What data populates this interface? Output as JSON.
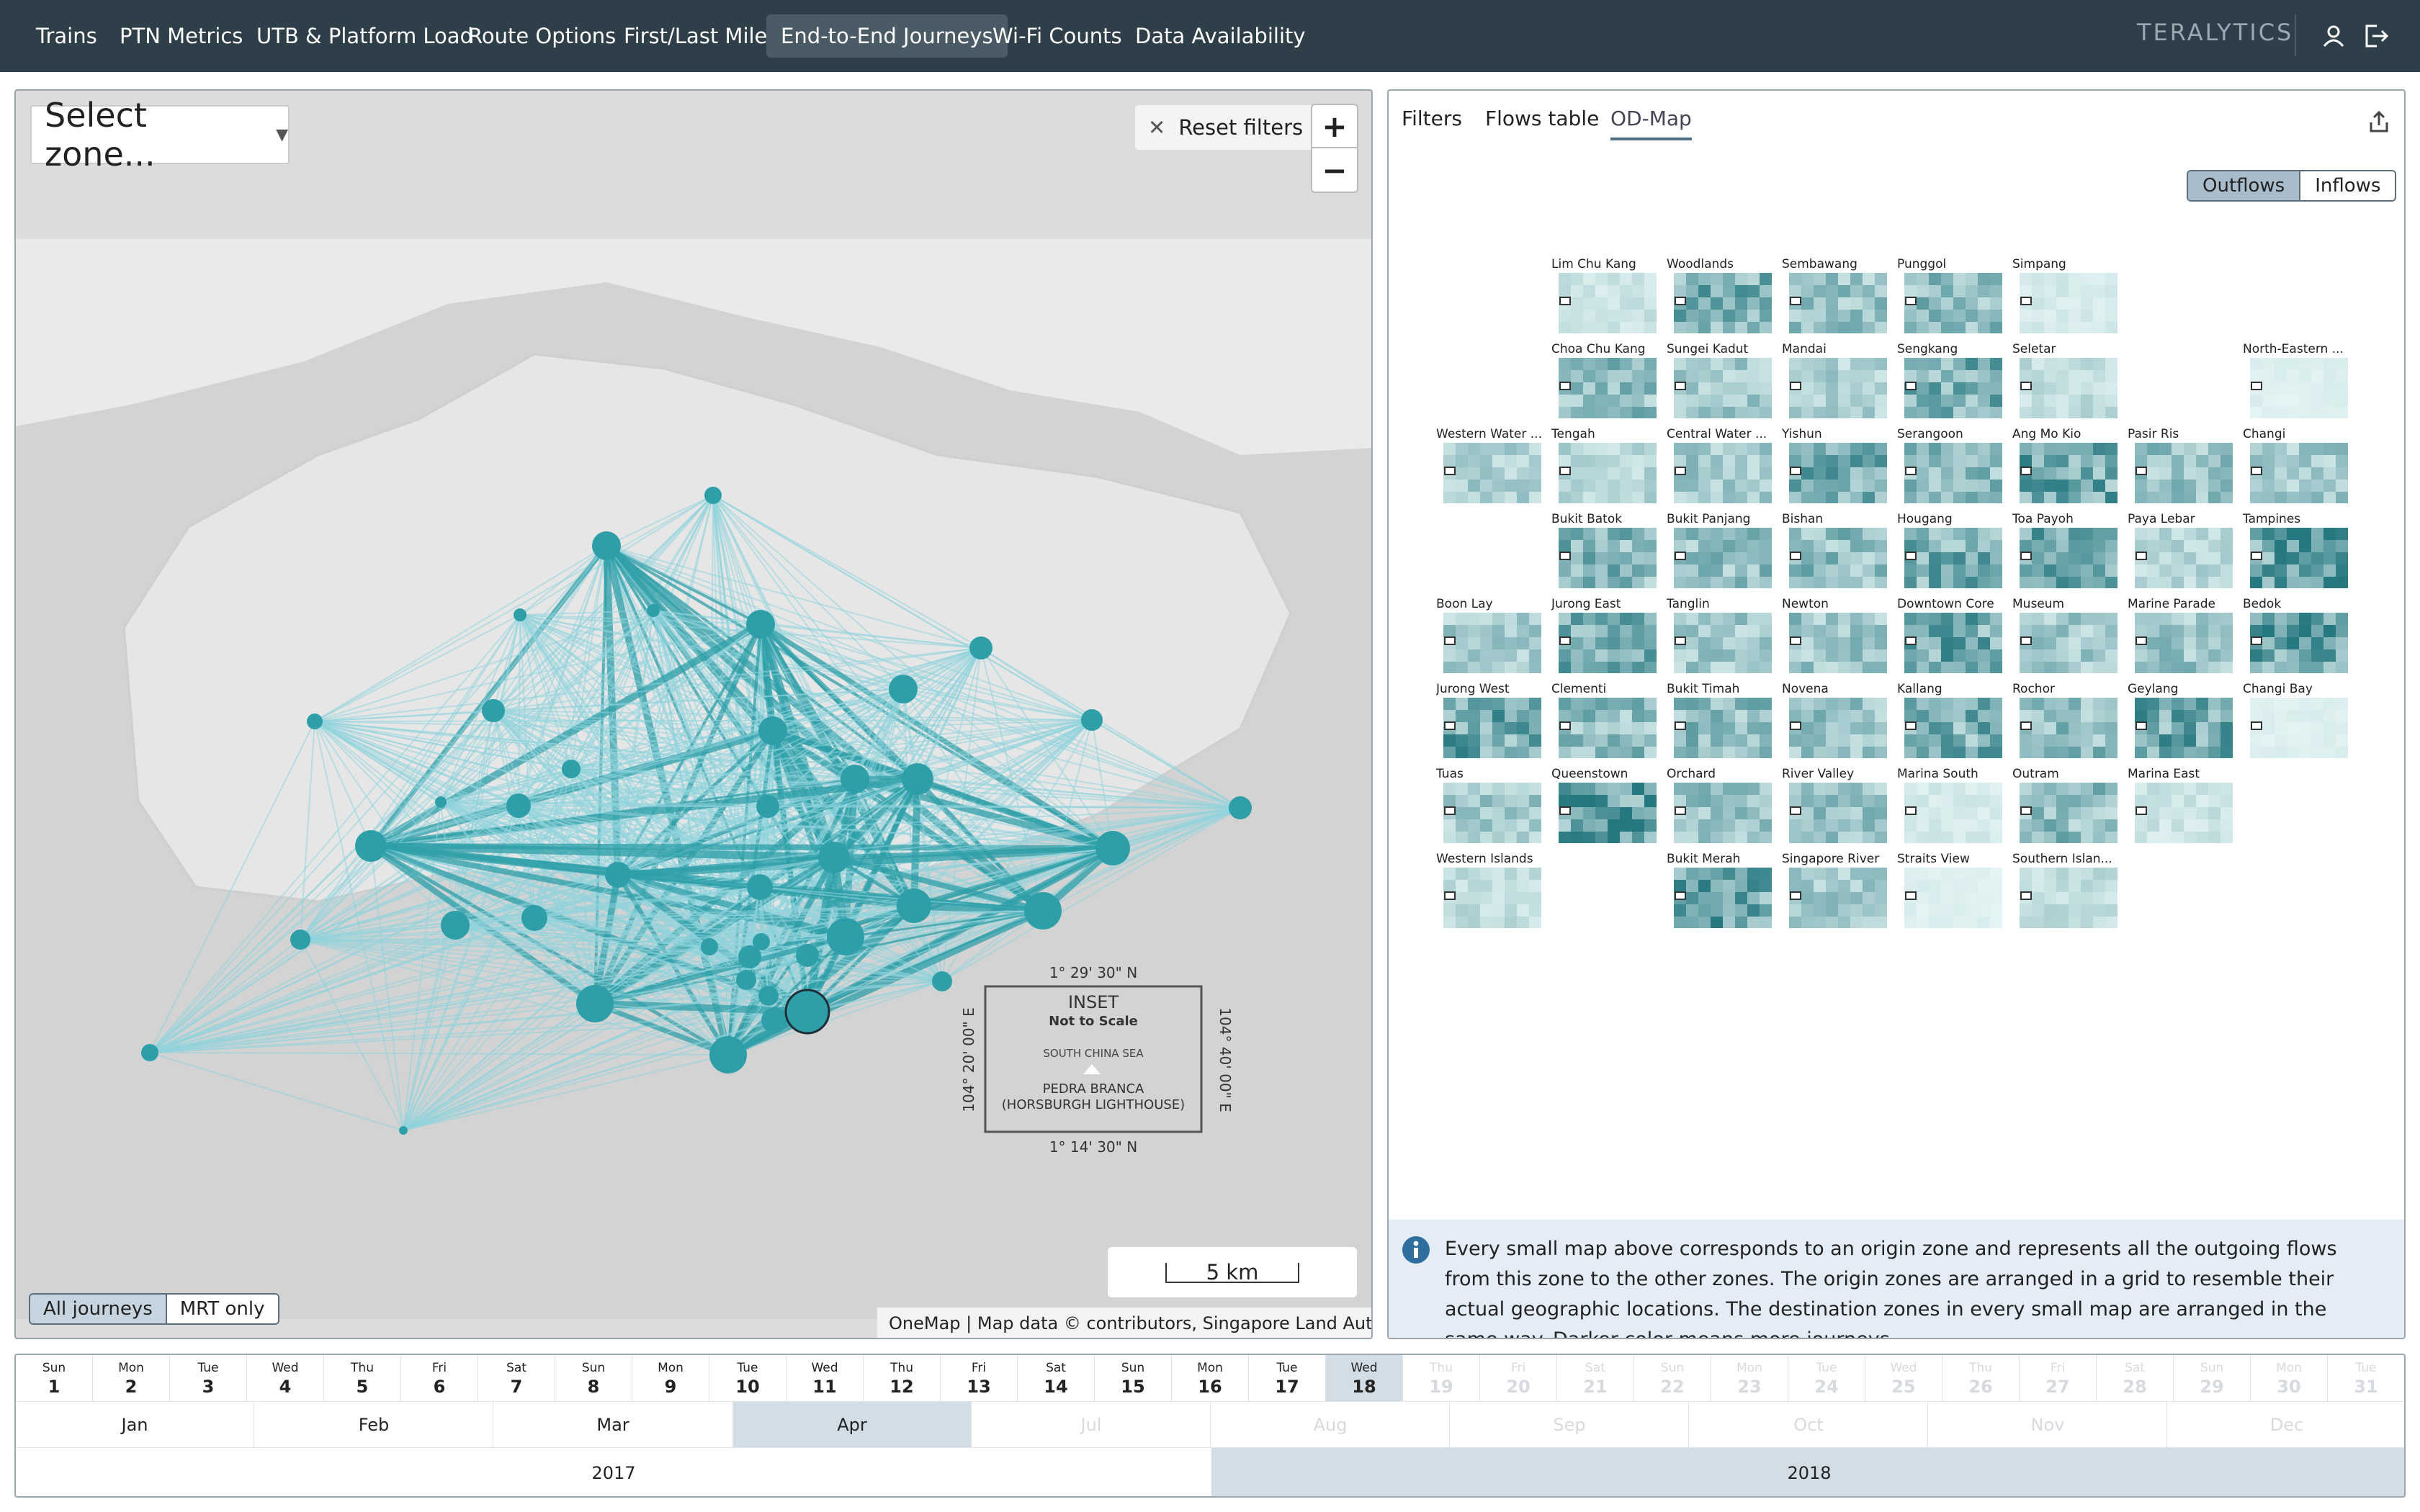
{
  "nav": {
    "tabs": [
      "Trains",
      "PTN Metrics",
      "UTB & Platform Load",
      "Route Options",
      "First/Last Mile",
      "End-to-End Journeys",
      "Wi-Fi Counts",
      "Data Availability"
    ],
    "active_tab": "End-to-End Journeys",
    "brand": "TERALYTICS",
    "user_icon": "user-icon",
    "logout_icon": "logout-icon"
  },
  "map": {
    "zone_select": "Select zone...",
    "reset_filters": "Reset filters",
    "zoom_in": "+",
    "zoom_out": "−",
    "scale_label": "5 km",
    "attribution": "OneMap | Map data © contributors, Singapore Land Authority",
    "journey_modes": [
      "All journeys",
      "MRT only"
    ],
    "active_mode": "All journeys",
    "flow_color": "#2e9fa8",
    "inset": {
      "title": "INSET",
      "subtitle": "Not to Scale",
      "sea": "SOUTH CHINA SEA",
      "island": "PEDRA BRANCA",
      "lighthouse": "(HORSBURGH LIGHTHOUSE)",
      "lat_top": "1° 29' 30\" N",
      "lat_bottom": "1° 14' 30\" N",
      "lon_left": "104° 20' 00\" E",
      "lon_right": "104° 40' 00\" E"
    }
  },
  "right_panel": {
    "tabs": [
      "Filters",
      "Flows table",
      "OD-Map"
    ],
    "active_tab": "OD-Map",
    "flow_modes": [
      "Outflows",
      "Inflows"
    ],
    "active_flow": "Outflows",
    "zones": [
      {
        "name": "Lim Chu Kang",
        "col": 1,
        "row": 0,
        "intensity": 0.15
      },
      {
        "name": "Woodlands",
        "col": 2,
        "row": 0,
        "intensity": 0.55
      },
      {
        "name": "Sembawang",
        "col": 3,
        "row": 0,
        "intensity": 0.4
      },
      {
        "name": "Punggol",
        "col": 4,
        "row": 0,
        "intensity": 0.45
      },
      {
        "name": "Simpang",
        "col": 5,
        "row": 0,
        "intensity": 0.1
      },
      {
        "name": "Choa Chu Kang",
        "col": 1,
        "row": 1,
        "intensity": 0.45
      },
      {
        "name": "Sungei Kadut",
        "col": 2,
        "row": 1,
        "intensity": 0.35
      },
      {
        "name": "Mandai",
        "col": 3,
        "row": 1,
        "intensity": 0.3
      },
      {
        "name": "Sengkang",
        "col": 4,
        "row": 1,
        "intensity": 0.55
      },
      {
        "name": "Seletar",
        "col": 5,
        "row": 1,
        "intensity": 0.2
      },
      {
        "name": "North-Eastern ...",
        "col": 7,
        "row": 1,
        "intensity": 0.05
      },
      {
        "name": "Western Water ...",
        "col": 0,
        "row": 2,
        "intensity": 0.3
      },
      {
        "name": "Tengah",
        "col": 1,
        "row": 2,
        "intensity": 0.25
      },
      {
        "name": "Central Water ...",
        "col": 2,
        "row": 2,
        "intensity": 0.35
      },
      {
        "name": "Yishun",
        "col": 3,
        "row": 2,
        "intensity": 0.55
      },
      {
        "name": "Serangoon",
        "col": 4,
        "row": 2,
        "intensity": 0.45
      },
      {
        "name": "Ang Mo Kio",
        "col": 5,
        "row": 2,
        "intensity": 0.6
      },
      {
        "name": "Pasir Ris",
        "col": 6,
        "row": 2,
        "intensity": 0.4
      },
      {
        "name": "Changi",
        "col": 7,
        "row": 2,
        "intensity": 0.35
      },
      {
        "name": "Bukit Batok",
        "col": 1,
        "row": 3,
        "intensity": 0.5
      },
      {
        "name": "Bukit Panjang",
        "col": 2,
        "row": 3,
        "intensity": 0.45
      },
      {
        "name": "Bishan",
        "col": 3,
        "row": 3,
        "intensity": 0.45
      },
      {
        "name": "Hougang",
        "col": 4,
        "row": 3,
        "intensity": 0.55
      },
      {
        "name": "Toa Payoh",
        "col": 5,
        "row": 3,
        "intensity": 0.6
      },
      {
        "name": "Paya Lebar",
        "col": 6,
        "row": 3,
        "intensity": 0.25
      },
      {
        "name": "Tampines",
        "col": 7,
        "row": 3,
        "intensity": 0.7
      },
      {
        "name": "Boon Lay",
        "col": 0,
        "row": 4,
        "intensity": 0.35
      },
      {
        "name": "Jurong East",
        "col": 1,
        "row": 4,
        "intensity": 0.55
      },
      {
        "name": "Tanglin",
        "col": 2,
        "row": 4,
        "intensity": 0.35
      },
      {
        "name": "Newton",
        "col": 3,
        "row": 4,
        "intensity": 0.4
      },
      {
        "name": "Downtown Core",
        "col": 4,
        "row": 4,
        "intensity": 0.6
      },
      {
        "name": "Museum",
        "col": 5,
        "row": 4,
        "intensity": 0.35
      },
      {
        "name": "Marine Parade",
        "col": 6,
        "row": 4,
        "intensity": 0.4
      },
      {
        "name": "Bedok",
        "col": 7,
        "row": 4,
        "intensity": 0.7
      },
      {
        "name": "Jurong West",
        "col": 0,
        "row": 5,
        "intensity": 0.6
      },
      {
        "name": "Clementi",
        "col": 1,
        "row": 5,
        "intensity": 0.45
      },
      {
        "name": "Bukit Timah",
        "col": 2,
        "row": 5,
        "intensity": 0.45
      },
      {
        "name": "Novena",
        "col": 3,
        "row": 5,
        "intensity": 0.4
      },
      {
        "name": "Kallang",
        "col": 4,
        "row": 5,
        "intensity": 0.55
      },
      {
        "name": "Rochor",
        "col": 5,
        "row": 5,
        "intensity": 0.45
      },
      {
        "name": "Geylang",
        "col": 6,
        "row": 5,
        "intensity": 0.6
      },
      {
        "name": "Changi Bay",
        "col": 7,
        "row": 5,
        "intensity": 0.05
      },
      {
        "name": "Tuas",
        "col": 0,
        "row": 6,
        "intensity": 0.35
      },
      {
        "name": "Queenstown",
        "col": 1,
        "row": 6,
        "intensity": 0.7
      },
      {
        "name": "Orchard",
        "col": 2,
        "row": 6,
        "intensity": 0.4
      },
      {
        "name": "River Valley",
        "col": 3,
        "row": 6,
        "intensity": 0.4
      },
      {
        "name": "Marina South",
        "col": 4,
        "row": 6,
        "intensity": 0.1
      },
      {
        "name": "Outram",
        "col": 5,
        "row": 6,
        "intensity": 0.45
      },
      {
        "name": "Marina East",
        "col": 6,
        "row": 6,
        "intensity": 0.15
      },
      {
        "name": "Western Islands",
        "col": 0,
        "row": 7,
        "intensity": 0.2
      },
      {
        "name": "Bukit Merah",
        "col": 2,
        "row": 7,
        "intensity": 0.65
      },
      {
        "name": "Singapore River",
        "col": 3,
        "row": 7,
        "intensity": 0.35
      },
      {
        "name": "Straits View",
        "col": 4,
        "row": 7,
        "intensity": 0.05
      },
      {
        "name": "Southern Islan...",
        "col": 5,
        "row": 7,
        "intensity": 0.2
      }
    ],
    "info_icon": "info-icon",
    "info_text": "Every small map above corresponds to an origin zone and represents all the outgoing flows from this zone to the other zones. The origin zones are arranged in a grid to resemble their actual geographic locations. The destination zones in every small map are arranged in the same way. Darker color means more journeys."
  },
  "timeline": {
    "days": [
      {
        "n": "Sun",
        "d": "1"
      },
      {
        "n": "Mon",
        "d": "2"
      },
      {
        "n": "Tue",
        "d": "3"
      },
      {
        "n": "Wed",
        "d": "4"
      },
      {
        "n": "Thu",
        "d": "5"
      },
      {
        "n": "Fri",
        "d": "6"
      },
      {
        "n": "Sat",
        "d": "7"
      },
      {
        "n": "Sun",
        "d": "8"
      },
      {
        "n": "Mon",
        "d": "9"
      },
      {
        "n": "Tue",
        "d": "10"
      },
      {
        "n": "Wed",
        "d": "11"
      },
      {
        "n": "Thu",
        "d": "12"
      },
      {
        "n": "Fri",
        "d": "13"
      },
      {
        "n": "Sat",
        "d": "14"
      },
      {
        "n": "Sun",
        "d": "15"
      },
      {
        "n": "Mon",
        "d": "16"
      },
      {
        "n": "Tue",
        "d": "17"
      },
      {
        "n": "Wed",
        "d": "18"
      },
      {
        "n": "Thu",
        "d": "19"
      },
      {
        "n": "Fri",
        "d": "20"
      },
      {
        "n": "Sat",
        "d": "21"
      },
      {
        "n": "Sun",
        "d": "22"
      },
      {
        "n": "Mon",
        "d": "23"
      },
      {
        "n": "Tue",
        "d": "24"
      },
      {
        "n": "Wed",
        "d": "25"
      },
      {
        "n": "Thu",
        "d": "26"
      },
      {
        "n": "Fri",
        "d": "27"
      },
      {
        "n": "Sat",
        "d": "28"
      },
      {
        "n": "Sun",
        "d": "29"
      },
      {
        "n": "Mon",
        "d": "30"
      },
      {
        "n": "Tue",
        "d": "31"
      }
    ],
    "selected_day": "18",
    "last_available_day": 18,
    "months": [
      "Jan",
      "Feb",
      "Mar",
      "Apr",
      "Jul",
      "Aug",
      "Sep",
      "Oct",
      "Nov",
      "Dec"
    ],
    "months_available": 4,
    "selected_month": "Apr",
    "years": [
      "2017",
      "2018"
    ],
    "selected_year": "2018"
  }
}
